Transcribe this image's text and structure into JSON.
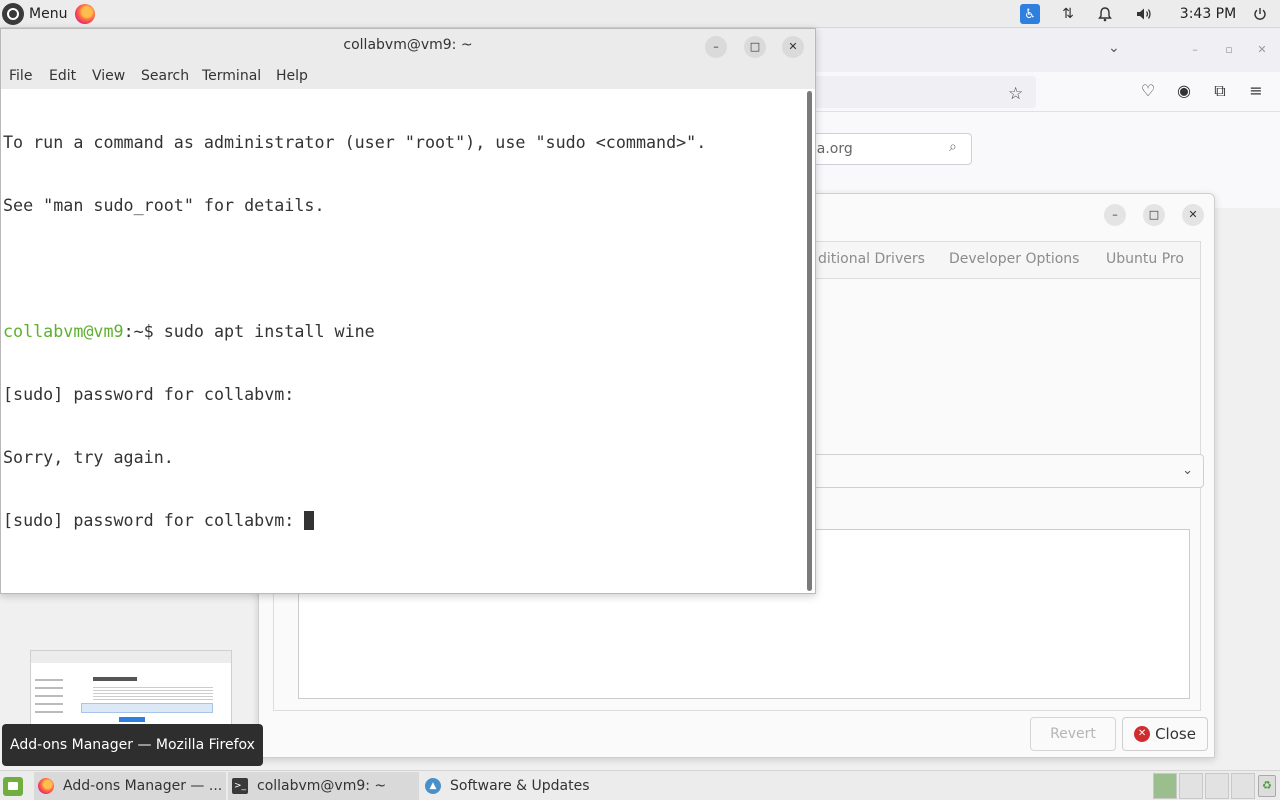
{
  "top_panel": {
    "menu_label": "Menu",
    "clock": "3:43 PM"
  },
  "firefox_window": {
    "search_text": "lla.org"
  },
  "software_updates": {
    "tabs": [
      "ditional Drivers",
      "Developer Options",
      "Ubuntu Pro"
    ],
    "revert_label": "Revert",
    "close_label": "Close"
  },
  "terminal": {
    "title": "collabvm@vm9: ~",
    "menu": [
      "File",
      "Edit",
      "View",
      "Search",
      "Terminal",
      "Help"
    ],
    "lines": {
      "l1": "To run a command as administrator (user \"root\"), use \"sudo <command>\".",
      "l2": "See \"man sudo_root\" for details.",
      "prompt": "collabvm@vm9",
      "prompt_rest": ":~$ sudo apt install wine",
      "l4": "[sudo] password for collabvm:",
      "l5": "Sorry, try again.",
      "l6": "[sudo] password for collabvm: "
    }
  },
  "tooltip": "Add-ons Manager — Mozilla Firefox",
  "taskbar": {
    "tasks": [
      "Add-ons Manager — ...",
      "collabvm@vm9: ~",
      "Software & Updates"
    ]
  }
}
